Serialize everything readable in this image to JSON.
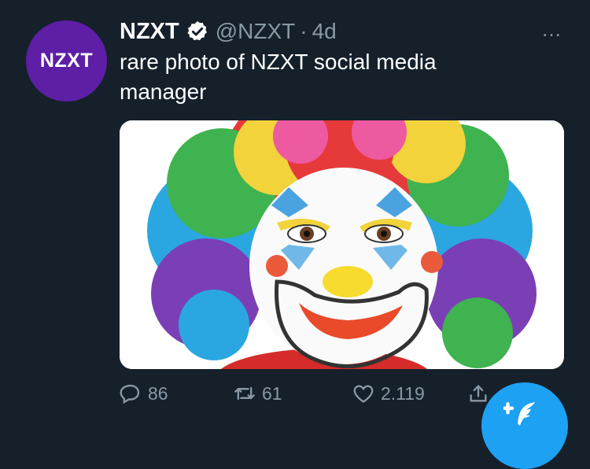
{
  "tweet": {
    "avatar_text": "NZXT",
    "name": "NZXT",
    "handle": "@NZXT",
    "separator": "·",
    "time": "4d",
    "text": "rare photo of NZXT social media manager",
    "more_icon": "…"
  },
  "actions": {
    "reply_count": "86",
    "retweet_count": "61",
    "like_count": "2.119"
  },
  "colors": {
    "background": "#15202b",
    "secondary_text": "#8899a6",
    "accent": "#1da1f2",
    "avatar_bg": "#5e1ea6"
  },
  "icons": [
    "verified-badge-icon",
    "more-options-icon",
    "reply-icon",
    "retweet-icon",
    "like-icon",
    "share-icon",
    "compose-tweet-icon"
  ]
}
